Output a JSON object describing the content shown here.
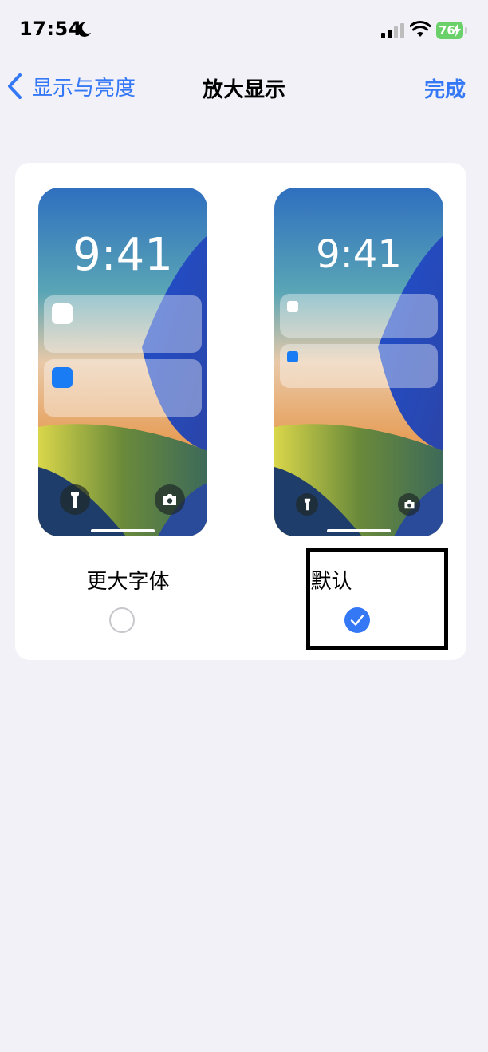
{
  "status_bar": {
    "time": "17:54",
    "battery": "76"
  },
  "nav": {
    "back_label": "显示与亮度",
    "title": "放大显示",
    "done_label": "完成"
  },
  "options": [
    {
      "clock": "9:41",
      "label": "更大字体",
      "selected": false
    },
    {
      "clock": "9:41",
      "label": "默认",
      "selected": true
    }
  ],
  "colors": {
    "accent": "#3478f6",
    "background": "#f2f1f7",
    "battery": "#6ad16a"
  },
  "icons": [
    "moon-icon",
    "cellular-signal-icon",
    "wifi-icon",
    "battery-icon",
    "chevron-left-icon",
    "flashlight-icon",
    "camera-icon",
    "checkmark-icon"
  ]
}
